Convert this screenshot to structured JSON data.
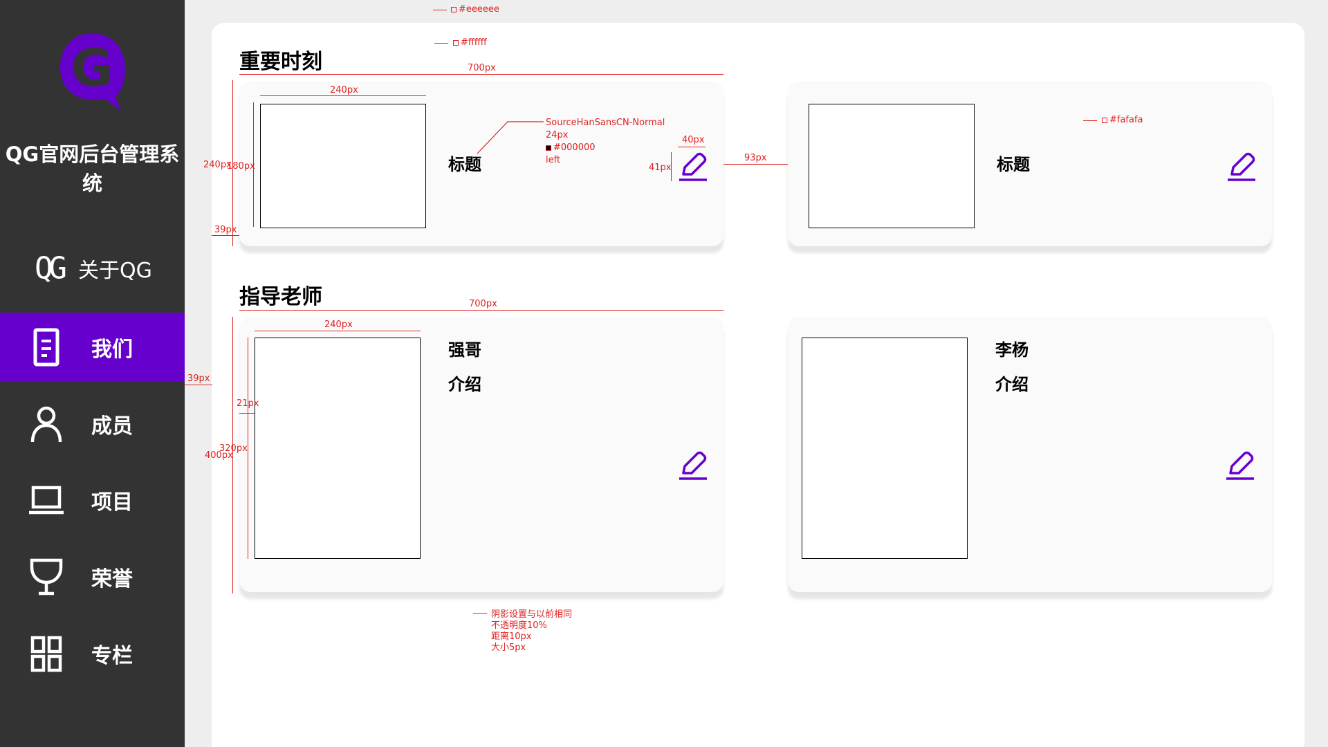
{
  "app": {
    "title": "QG官网后台管理系统",
    "logo_letter": "G"
  },
  "sidebar": {
    "items": [
      {
        "label": "关于QG",
        "icon": "qg-logo-icon",
        "mark": "QG",
        "active": false
      },
      {
        "label": "我们",
        "icon": "document-icon",
        "active": true
      },
      {
        "label": "成员",
        "icon": "user-icon",
        "active": false
      },
      {
        "label": "项目",
        "icon": "laptop-icon",
        "active": false
      },
      {
        "label": "荣誉",
        "icon": "trophy-icon",
        "active": false
      },
      {
        "label": "专栏",
        "icon": "grid-icon",
        "active": false
      }
    ]
  },
  "colors": {
    "sidebar_bg": "#333333",
    "accent": "#6600cc",
    "page_bg": "#eeeeee",
    "panel_bg": "#ffffff",
    "card_bg": "#fafafa",
    "annotation": "#e02020"
  },
  "moments": {
    "title": "重要时刻",
    "cards": [
      {
        "title": "标题"
      },
      {
        "title": "标题"
      }
    ]
  },
  "teachers": {
    "title": "指导老师",
    "cards": [
      {
        "name": "强哥",
        "intro": "介绍"
      },
      {
        "name": "李杨",
        "intro": "介绍"
      }
    ]
  },
  "annotations": {
    "page_bg_color": "#eeeeee",
    "panel_color": "#ffffff",
    "card_color": "#fafafa",
    "font_spec": [
      "SourceHanSansCN-Normal",
      "24px",
      "#000000",
      "left"
    ],
    "dims": {
      "w700a": "700px",
      "w240a": "240px",
      "h240": "240px",
      "h180": "180px",
      "m39a": "39px",
      "w40": "40px",
      "h41": "41px",
      "gap93": "93px",
      "w700b": "700px",
      "w240b": "240px",
      "m39b": "39px",
      "m21": "21px",
      "h320": "320px",
      "h400": "400px"
    },
    "shadow_note": [
      "阴影设置与以前相同",
      "不透明度10%",
      "距离10px",
      "大小5px"
    ]
  }
}
